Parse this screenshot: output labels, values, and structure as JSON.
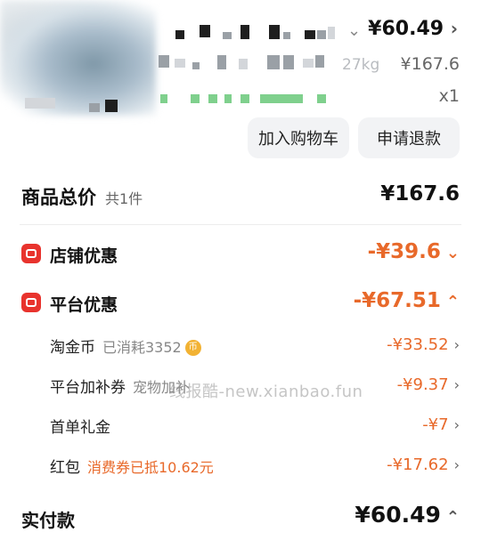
{
  "product": {
    "price": "¥60.49",
    "weight": "27kg",
    "original_price": "¥167.6",
    "quantity": "x1",
    "chevron_right": "›",
    "chevron_down": "⌄"
  },
  "actions": {
    "add_to_cart": "加入购物车",
    "refund": "申请退款"
  },
  "summary": {
    "total_label": "商品总价",
    "total_count": "共1件",
    "total_price": "¥167.6"
  },
  "store_discount": {
    "icon": "store-icon",
    "label": "店铺优惠",
    "value": "-¥39.6",
    "chevron": "⌄"
  },
  "platform_discount": {
    "icon": "platform-icon",
    "label": "平台优惠",
    "value": "-¥67.51",
    "chevron": "⌃",
    "items": [
      {
        "label": "淘金币",
        "note": "已消耗3352",
        "value": "-¥33.52"
      },
      {
        "label": "平台加补券",
        "note": "宠物加补",
        "value": "-¥9.37"
      },
      {
        "label": "首单礼金",
        "note": "",
        "value": "-¥7"
      },
      {
        "label": "红包",
        "note": "消费券已抵10.62元",
        "value": "-¥17.62"
      }
    ],
    "coin_glyph": "币",
    "row_chevron": "›"
  },
  "payment": {
    "label": "实付款",
    "value": "¥60.49",
    "chevron": "⌃"
  },
  "watermark": "线报酷-new.xianbao.fun",
  "colors": {
    "accent": "#e8692a",
    "badge_red": "#e8332d",
    "coin": "#f2b233",
    "button_bg": "#f2f3f5"
  }
}
